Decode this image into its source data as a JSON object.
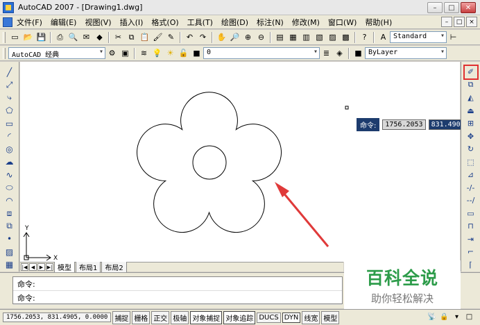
{
  "window": {
    "title": "AutoCAD 2007 - [Drawing1.dwg]",
    "buttons": [
      "–",
      "□",
      "✕"
    ]
  },
  "menu": {
    "items": [
      "文件(F)",
      "编辑(E)",
      "视图(V)",
      "插入(I)",
      "格式(O)",
      "工具(T)",
      "绘图(D)",
      "标注(N)",
      "修改(M)",
      "窗口(W)",
      "帮助(H)"
    ],
    "mdi_buttons": [
      "–",
      "□",
      "×"
    ]
  },
  "toolbar1": {
    "text_style": "Standard"
  },
  "toolbar2": {
    "workspace": "AutoCAD 经典",
    "layer": "0",
    "color": "ByLayer"
  },
  "tools": {
    "left": [
      "line-icon",
      "construction-line-icon",
      "polyline-icon",
      "polygon-icon",
      "rectangle-icon",
      "arc-icon",
      "circle-icon",
      "revision-cloud-icon",
      "spline-icon",
      "ellipse-icon",
      "ellipse-arc-icon",
      "insert-block-icon",
      "make-block-icon",
      "point-icon",
      "hatch-icon",
      "gradient-icon"
    ],
    "right": [
      "erase-icon",
      "copy-icon",
      "mirror-icon",
      "offset-icon",
      "array-icon",
      "move-icon",
      "rotate-icon",
      "scale-icon",
      "stretch-icon",
      "trim-icon",
      "extend-icon",
      "break-icon",
      "join-icon",
      "chamfer-icon",
      "fillet-icon",
      "explode-icon"
    ]
  },
  "drawing": {
    "ucs_x": "X",
    "ucs_y": "Y"
  },
  "dynamic_input": {
    "label": "命令:",
    "x_value": "1756.2053",
    "y_value": "831.4905"
  },
  "layout_tabs": [
    "模型",
    "布局1",
    "布局2"
  ],
  "command": {
    "lines": [
      "命令:",
      "命令:"
    ]
  },
  "watermark": {
    "title": "百科全说",
    "subtitle": "助你轻松解决"
  },
  "status": {
    "coordinates": "1756.2053, 831.4905, 0.0000",
    "buttons": [
      "捕捉",
      "栅格",
      "正交",
      "极轴",
      "对象捕捉",
      "对象追踪",
      "DUCS",
      "DYN",
      "线宽",
      "模型"
    ]
  }
}
